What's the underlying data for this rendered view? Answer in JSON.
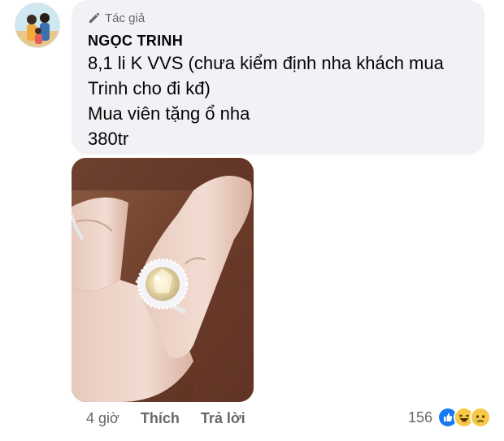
{
  "author": {
    "badge_label": "Tác giả",
    "badge_icon": "pencil-icon",
    "name": "NGỌC TRINH"
  },
  "comment": {
    "lines": [
      "8,1 li K VVS (chưa kiểm định nha khách mua",
      "Trinh cho đi kđ)",
      "Mua viên tặng ổ nha",
      "380tr"
    ]
  },
  "attachment": {
    "type": "photo",
    "subject_icon": "ring-photo"
  },
  "actions": {
    "timestamp": "4 giờ",
    "like_label": "Thích",
    "reply_label": "Trả lời"
  },
  "reactions": {
    "count": "156",
    "types": [
      "like-icon",
      "haha-icon",
      "sad-icon"
    ]
  },
  "colors": {
    "bubble_bg": "#f0f2f5",
    "secondary_text": "#65676b",
    "primary_text": "#050505",
    "like_blue": "#1877f2",
    "emoji_yellow": "#f7c948"
  }
}
